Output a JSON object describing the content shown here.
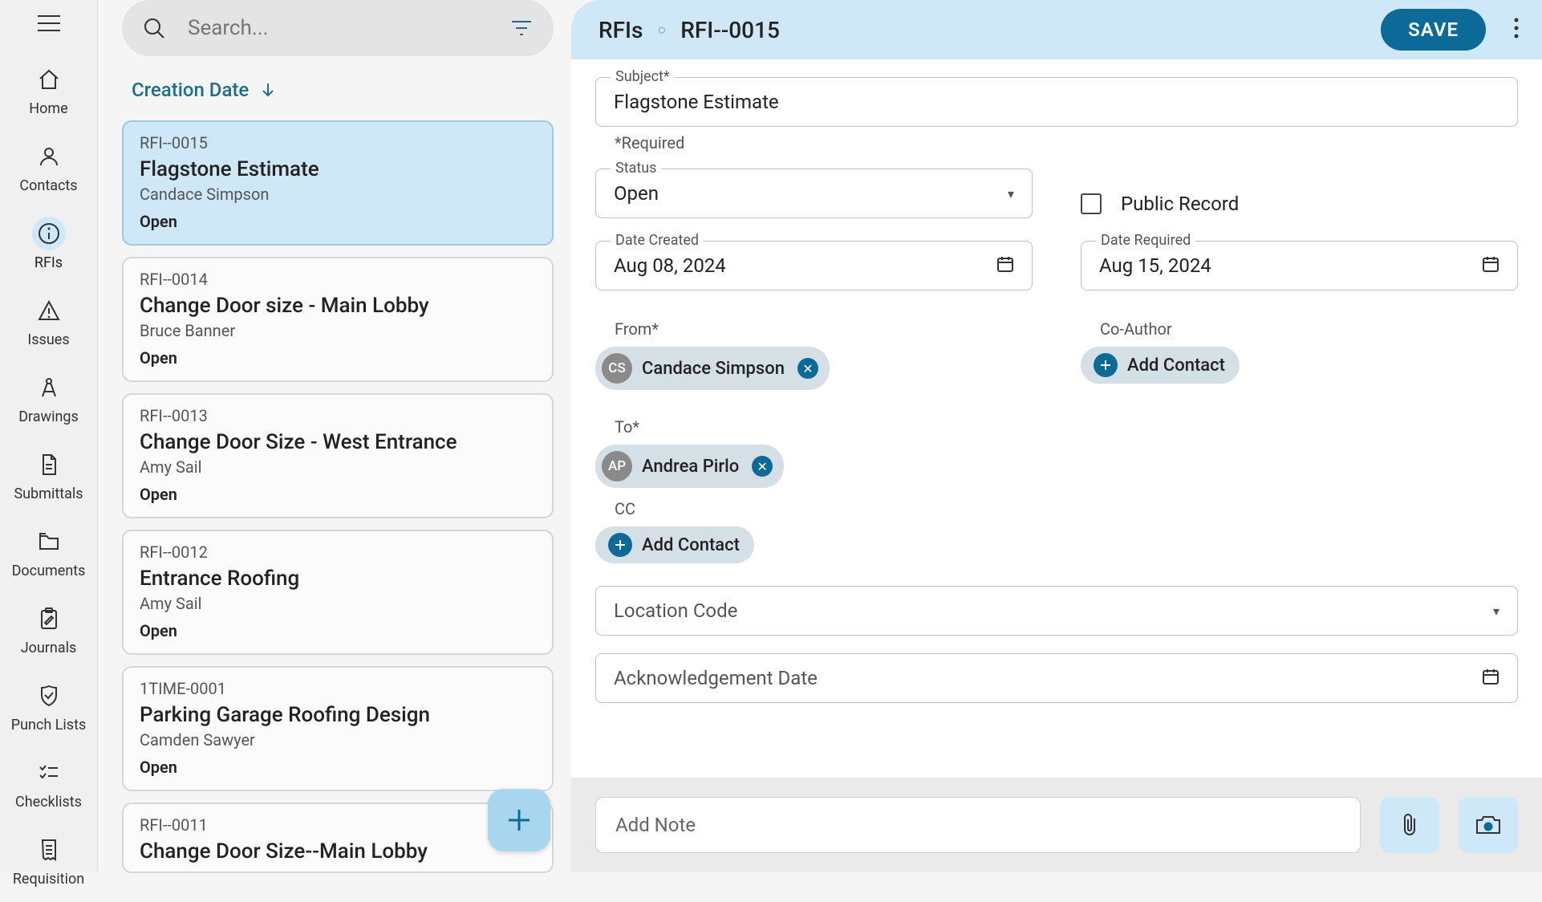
{
  "rail": {
    "items": [
      {
        "label": "Home"
      },
      {
        "label": "Contacts"
      },
      {
        "label": "RFIs"
      },
      {
        "label": "Issues"
      },
      {
        "label": "Drawings"
      },
      {
        "label": "Submittals"
      },
      {
        "label": "Documents"
      },
      {
        "label": "Journals"
      },
      {
        "label": "Punch Lists"
      },
      {
        "label": "Checklists"
      },
      {
        "label": "Requisition"
      }
    ]
  },
  "search": {
    "placeholder": "Search..."
  },
  "sort": {
    "label": "Creation Date"
  },
  "list": [
    {
      "id": "RFI--0015",
      "title": "Flagstone Estimate",
      "author": "Candace Simpson",
      "status": "Open"
    },
    {
      "id": "RFI--0014",
      "title": "Change Door size - Main Lobby",
      "author": "Bruce Banner",
      "status": "Open"
    },
    {
      "id": "RFI--0013",
      "title": "Change Door Size - West Entrance",
      "author": "Amy Sail",
      "status": "Open"
    },
    {
      "id": "RFI--0012",
      "title": "Entrance Roofing",
      "author": "Amy Sail",
      "status": "Open"
    },
    {
      "id": "1TIME-0001",
      "title": "Parking Garage Roofing Design",
      "author": "Camden Sawyer",
      "status": "Open"
    },
    {
      "id": "RFI--0011",
      "title": "Change Door Size--Main Lobby",
      "author": "",
      "status": ""
    }
  ],
  "detail": {
    "breadcrumb_root": "RFIs",
    "breadcrumb_id": "RFI--0015",
    "save_label": "SAVE",
    "subject_label": "Subject*",
    "subject_value": "Flagstone Estimate",
    "required_note": "*Required",
    "status_label": "Status",
    "status_value": "Open",
    "public_record_label": "Public Record",
    "date_created_label": "Date Created",
    "date_created_value": "Aug 08, 2024",
    "date_required_label": "Date Required",
    "date_required_value": "Aug 15, 2024",
    "from_label": "From*",
    "from_chip": {
      "initials": "CS",
      "name": "Candace Simpson"
    },
    "coauthor_label": "Co-Author",
    "add_contact_label": "Add Contact",
    "to_label": "To*",
    "to_chip": {
      "initials": "AP",
      "name": "Andrea Pirlo"
    },
    "cc_label": "CC",
    "location_label": "Location Code",
    "ack_label": "Acknowledgement Date",
    "note_placeholder": "Add Note"
  }
}
